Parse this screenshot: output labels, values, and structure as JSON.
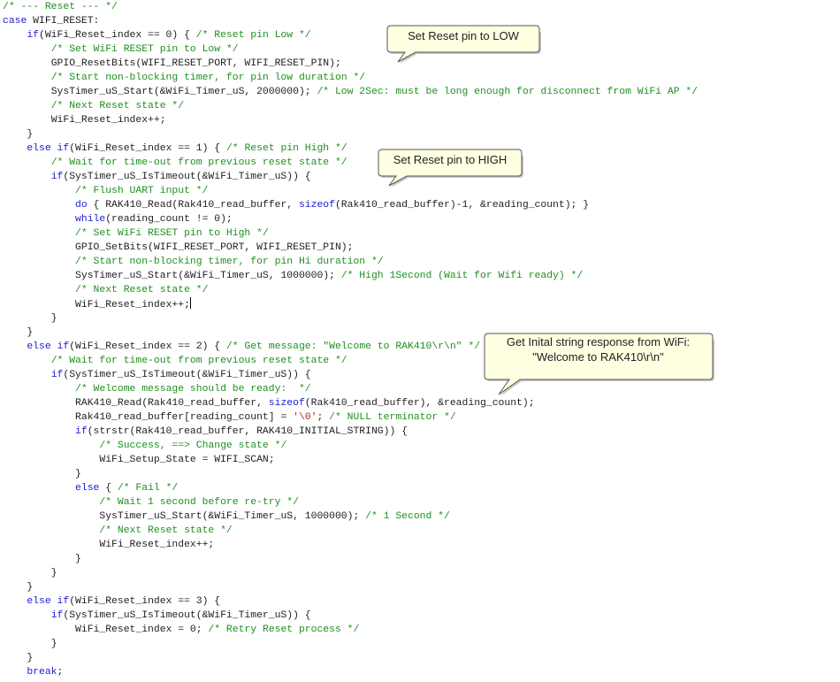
{
  "editor": {
    "lines": [
      {
        "indent": 0,
        "tokens": [
          [
            "cm",
            "/* --- Reset --- */"
          ]
        ]
      },
      {
        "indent": 0,
        "tokens": [
          [
            "kw",
            "case"
          ],
          [
            "id",
            " WIFI_RESET:"
          ]
        ]
      },
      {
        "indent": 1,
        "tokens": [
          [
            "kw",
            "if"
          ],
          [
            "id",
            "(WiFi_Reset_index == 0) { "
          ],
          [
            "cm",
            "/* Reset pin Low */"
          ]
        ]
      },
      {
        "indent": 2,
        "tokens": [
          [
            "cm",
            "/* Set WiFi RESET pin to Low */"
          ]
        ]
      },
      {
        "indent": 2,
        "tokens": [
          [
            "id",
            "GPIO_ResetBits(WIFI_RESET_PORT, WIFI_RESET_PIN);"
          ]
        ]
      },
      {
        "indent": 2,
        "tokens": [
          [
            "cm",
            "/* Start non-blocking timer, for pin low duration */"
          ]
        ]
      },
      {
        "indent": 2,
        "tokens": [
          [
            "id",
            "SysTimer_uS_Start(&WiFi_Timer_uS, 2000000); "
          ],
          [
            "cm",
            "/* Low 2Sec: must be long enough for disconnect from WiFi AP */"
          ]
        ]
      },
      {
        "indent": 2,
        "tokens": [
          [
            "cm",
            "/* Next Reset state */"
          ]
        ]
      },
      {
        "indent": 2,
        "tokens": [
          [
            "id",
            "WiFi_Reset_index++;"
          ]
        ]
      },
      {
        "indent": 1,
        "tokens": [
          [
            "id",
            "}"
          ]
        ]
      },
      {
        "indent": 1,
        "tokens": [
          [
            "kw",
            "else if"
          ],
          [
            "id",
            "(WiFi_Reset_index == 1) { "
          ],
          [
            "cm",
            "/* Reset pin High */"
          ]
        ]
      },
      {
        "indent": 2,
        "tokens": [
          [
            "cm",
            "/* Wait for time-out from previous reset state */"
          ]
        ]
      },
      {
        "indent": 2,
        "tokens": [
          [
            "kw",
            "if"
          ],
          [
            "id",
            "(SysTimer_uS_IsTimeout(&WiFi_Timer_uS)) {"
          ]
        ]
      },
      {
        "indent": 3,
        "tokens": [
          [
            "cm",
            "/* Flush UART input */"
          ]
        ]
      },
      {
        "indent": 3,
        "tokens": [
          [
            "kw",
            "do"
          ],
          [
            "id",
            " { RAK410_Read(Rak410_read_buffer, "
          ],
          [
            "kw",
            "sizeof"
          ],
          [
            "id",
            "(Rak410_read_buffer)-1, &reading_count); }"
          ]
        ]
      },
      {
        "indent": 3,
        "tokens": [
          [
            "kw",
            "while"
          ],
          [
            "id",
            "(reading_count != 0);"
          ]
        ]
      },
      {
        "indent": 3,
        "tokens": [
          [
            "cm",
            "/* Set WiFi RESET pin to High */"
          ]
        ]
      },
      {
        "indent": 3,
        "tokens": [
          [
            "id",
            "GPIO_SetBits(WIFI_RESET_PORT, WIFI_RESET_PIN);"
          ]
        ]
      },
      {
        "indent": 3,
        "tokens": [
          [
            "cm",
            "/* Start non-blocking timer, for pin Hi duration */"
          ]
        ]
      },
      {
        "indent": 3,
        "tokens": [
          [
            "id",
            "SysTimer_uS_Start(&WiFi_Timer_uS, 1000000); "
          ],
          [
            "cm",
            "/* High 1Second (Wait for Wifi ready) */"
          ]
        ]
      },
      {
        "indent": 3,
        "tokens": [
          [
            "cm",
            "/* Next Reset state */"
          ]
        ]
      },
      {
        "indent": 3,
        "tokens": [
          [
            "id",
            "WiFi_Reset_index++;"
          ],
          [
            "cursor",
            ""
          ]
        ]
      },
      {
        "indent": 2,
        "tokens": [
          [
            "id",
            "}"
          ]
        ]
      },
      {
        "indent": 1,
        "tokens": [
          [
            "id",
            "}"
          ]
        ]
      },
      {
        "indent": 1,
        "tokens": [
          [
            "kw",
            "else if"
          ],
          [
            "id",
            "(WiFi_Reset_index == 2) { "
          ],
          [
            "cm",
            "/* Get message: \"Welcome to RAK410\\r\\n\" */"
          ]
        ]
      },
      {
        "indent": 2,
        "tokens": [
          [
            "cm",
            "/* Wait for time-out from previous reset state */"
          ]
        ]
      },
      {
        "indent": 2,
        "tokens": [
          [
            "kw",
            "if"
          ],
          [
            "id",
            "(SysTimer_uS_IsTimeout(&WiFi_Timer_uS)) {"
          ]
        ]
      },
      {
        "indent": 3,
        "tokens": [
          [
            "cm",
            "/* Welcome message should be ready:  */"
          ]
        ]
      },
      {
        "indent": 3,
        "tokens": [
          [
            "id",
            "RAK410_Read(Rak410_read_buffer, "
          ],
          [
            "kw",
            "sizeof"
          ],
          [
            "id",
            "(Rak410_read_buffer), &reading_count);"
          ]
        ]
      },
      {
        "indent": 3,
        "tokens": [
          [
            "id",
            "Rak410_read_buffer[reading_count] = "
          ],
          [
            "st",
            "'\\0'"
          ],
          [
            "id",
            "; "
          ],
          [
            "cm",
            "/* NULL terminator */"
          ]
        ]
      },
      {
        "indent": 3,
        "tokens": [
          [
            "kw",
            "if"
          ],
          [
            "id",
            "(strstr(Rak410_read_buffer, RAK410_INITIAL_STRING)) {"
          ]
        ]
      },
      {
        "indent": 4,
        "tokens": [
          [
            "cm",
            "/* Success, ==> Change state */"
          ]
        ]
      },
      {
        "indent": 4,
        "tokens": [
          [
            "id",
            "WiFi_Setup_State = WIFI_SCAN;"
          ]
        ]
      },
      {
        "indent": 3,
        "tokens": [
          [
            "id",
            "}"
          ]
        ]
      },
      {
        "indent": 3,
        "tokens": [
          [
            "kw",
            "else"
          ],
          [
            "id",
            " { "
          ],
          [
            "cm",
            "/* Fail */"
          ]
        ]
      },
      {
        "indent": 4,
        "tokens": [
          [
            "cm",
            "/* Wait 1 second before re-try */"
          ]
        ]
      },
      {
        "indent": 4,
        "tokens": [
          [
            "id",
            "SysTimer_uS_Start(&WiFi_Timer_uS, 1000000); "
          ],
          [
            "cm",
            "/* 1 Second */"
          ]
        ]
      },
      {
        "indent": 4,
        "tokens": [
          [
            "cm",
            "/* Next Reset state */"
          ]
        ]
      },
      {
        "indent": 4,
        "tokens": [
          [
            "id",
            "WiFi_Reset_index++;"
          ]
        ]
      },
      {
        "indent": 3,
        "tokens": [
          [
            "id",
            "}"
          ]
        ]
      },
      {
        "indent": 2,
        "tokens": [
          [
            "id",
            "}"
          ]
        ]
      },
      {
        "indent": 1,
        "tokens": [
          [
            "id",
            "}"
          ]
        ]
      },
      {
        "indent": 1,
        "tokens": [
          [
            "kw",
            "else if"
          ],
          [
            "id",
            "(WiFi_Reset_index == 3) {"
          ]
        ]
      },
      {
        "indent": 2,
        "tokens": [
          [
            "kw",
            "if"
          ],
          [
            "id",
            "(SysTimer_uS_IsTimeout(&WiFi_Timer_uS)) {"
          ]
        ]
      },
      {
        "indent": 3,
        "tokens": [
          [
            "id",
            "WiFi_Reset_index = 0; "
          ],
          [
            "cm",
            "/* Retry Reset process */"
          ]
        ]
      },
      {
        "indent": 2,
        "tokens": [
          [
            "id",
            "}"
          ]
        ]
      },
      {
        "indent": 1,
        "tokens": [
          [
            "id",
            "}"
          ]
        ]
      },
      {
        "indent": 1,
        "tokens": [
          [
            "kw",
            "break"
          ],
          [
            "id",
            ";"
          ]
        ]
      }
    ]
  },
  "callouts": {
    "low": {
      "text": "Set Reset pin to LOW"
    },
    "high": {
      "text": "Set Reset pin to HIGH"
    },
    "initial": {
      "line1": "Get Inital string response from WiFi:",
      "line2": "\"Welcome to RAK410\\r\\n\""
    }
  },
  "colors": {
    "keyword": "#1a1ad8",
    "comment": "#1f8f1f",
    "string": "#b5261e",
    "identifier": "#1e1e1e",
    "callout_fill": "#ffffe1",
    "callout_border": "#555555"
  }
}
